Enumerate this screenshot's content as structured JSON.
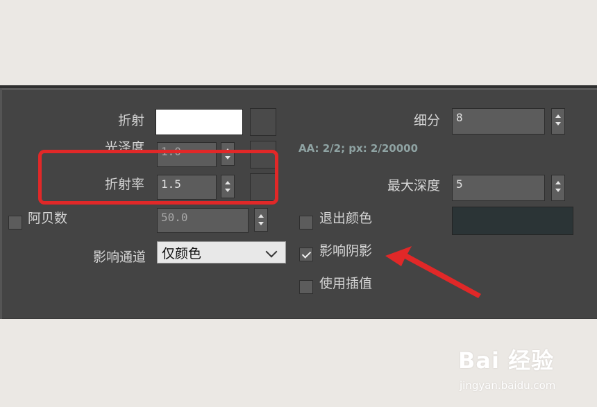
{
  "refraction": {
    "label": "折射",
    "glossiness": {
      "label": "光泽度",
      "value": "1.0"
    },
    "ior": {
      "label": "折射率",
      "value": "1.5"
    },
    "abbe": {
      "label": "阿贝数",
      "value": "50.0",
      "checked": false
    },
    "affect_channels": {
      "label": "影响通道",
      "selected": "仅颜色"
    }
  },
  "subdivs": {
    "label": "细分",
    "value": "8"
  },
  "aa_info": "AA: 2/2; px: 2/20000",
  "max_depth": {
    "label": "最大深度",
    "value": "5"
  },
  "exit_color": {
    "label": "退出颜色",
    "checked": false,
    "color": "#2b3436"
  },
  "affect_shadows": {
    "label": "影响阴影",
    "checked": true
  },
  "use_interpolation": {
    "label": "使用插值",
    "checked": false
  },
  "annotation": {
    "box_color": "#e12828",
    "arrow_color": "#e12828"
  },
  "watermark": {
    "brand": "Bai 经验",
    "url": "jingyan.baidu.com"
  }
}
